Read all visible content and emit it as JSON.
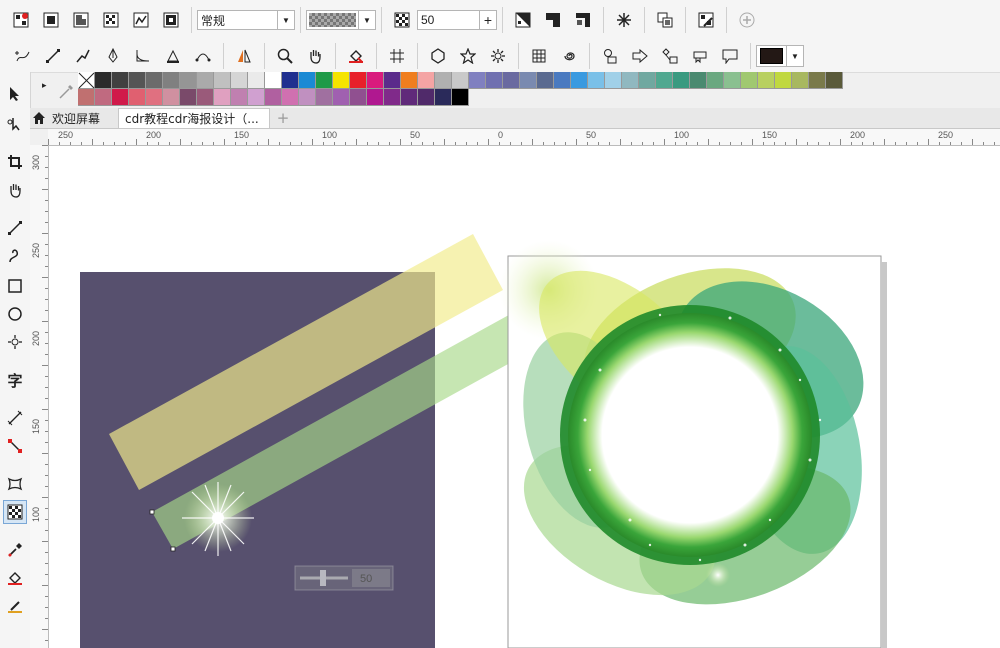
{
  "toolbar1": {
    "mode_select": "常规",
    "transparency_value": "50"
  },
  "tabs": [
    {
      "label": "欢迎屏幕"
    },
    {
      "label": "cdr教程cdr海报设计（..."
    }
  ],
  "ruler_top_labels": [
    "250",
    "200",
    "150",
    "100",
    "50",
    "0",
    "50",
    "100",
    "150",
    "200",
    "250"
  ],
  "ruler_left_labels": [
    "300",
    "250",
    "200",
    "150",
    "100"
  ],
  "canvas": {
    "slider_value": "50"
  },
  "palette_colors_row1": [
    "#2b2b2b",
    "#404040",
    "#555555",
    "#6b6b6b",
    "#808080",
    "#959595",
    "#aaaaaa",
    "#c0c0c0",
    "#d5d5d5",
    "#eaeaea",
    "#ffffff",
    "#1f2f8f",
    "#1a8ad4",
    "#1f9a48",
    "#f5e400",
    "#e8202a",
    "#d91a7d",
    "#5b2b8b",
    "#f07e1f",
    "#f4a4a4",
    "#b0b0b0",
    "#c9c9c9",
    "#8080c0",
    "#7070b0",
    "#6a6aa0",
    "#7a8ab0",
    "#5a6a90",
    "#4a7ac0",
    "#3a9ae0",
    "#7ac0e8",
    "#a0d0e8",
    "#90b8c0",
    "#70a8a0",
    "#50a890",
    "#3a9a80",
    "#4a8a70",
    "#6aa880",
    "#8ac090",
    "#a0c870",
    "#b8d060",
    "#c0d840",
    "#a8b860",
    "#7a7a4a",
    "#5a5a3a"
  ],
  "palette_colors_row2": [
    "#c07070",
    "#c06a80",
    "#d01a4a",
    "#e06070",
    "#e07080",
    "#d090a0",
    "#7a4a6a",
    "#9a5a7a",
    "#e0a0c0",
    "#c080b0",
    "#d0a0d0",
    "#b060a0",
    "#d070b0",
    "#c090c0",
    "#a070a0",
    "#a060b0",
    "#905090",
    "#b01890",
    "#802a8a",
    "#602a7a",
    "#502a6a",
    "#2a2a5a",
    "#000000"
  ],
  "outline_color": "#231815"
}
